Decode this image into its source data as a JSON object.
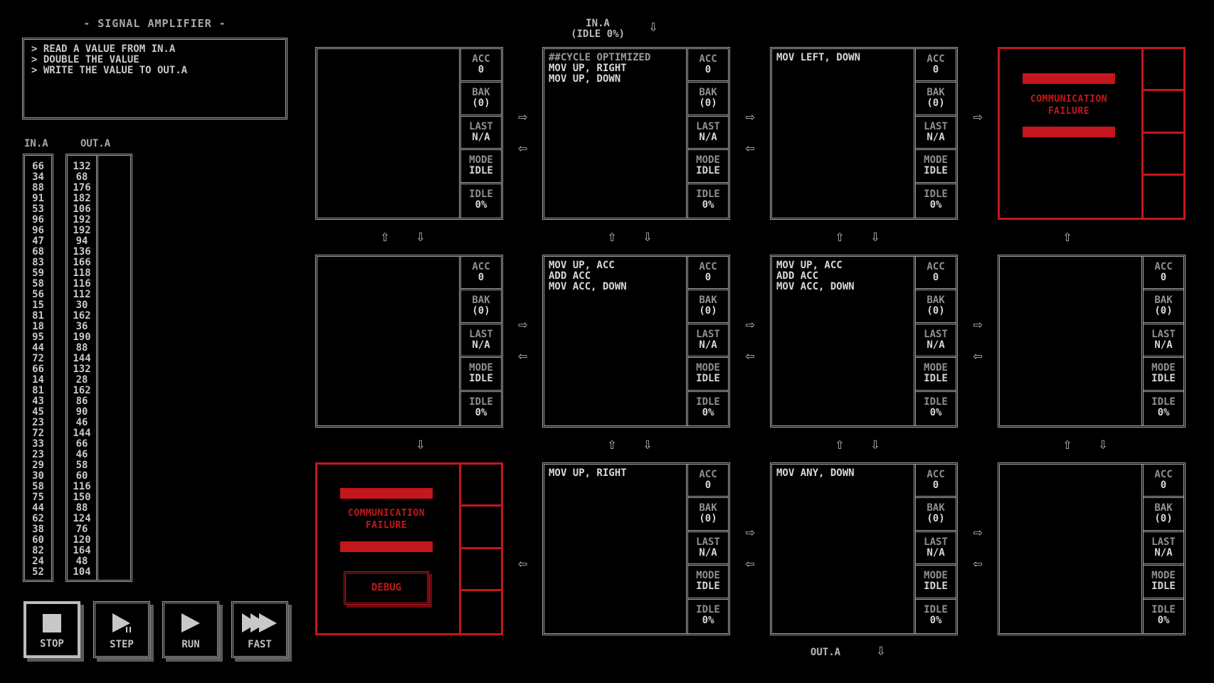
{
  "puzzle": {
    "title": "- SIGNAL AMPLIFIER -",
    "description": [
      "> READ A VALUE FROM IN.A",
      "> DOUBLE THE VALUE",
      "> WRITE THE VALUE TO OUT.A"
    ]
  },
  "streams": {
    "in_label": "IN.A",
    "out_label": "OUT.A",
    "in_values": [
      "66",
      "34",
      "88",
      "91",
      "53",
      "96",
      "96",
      "47",
      "68",
      "83",
      "59",
      "58",
      "56",
      "15",
      "81",
      "18",
      "95",
      "44",
      "72",
      "66",
      "14",
      "81",
      "43",
      "45",
      "23",
      "72",
      "33",
      "23",
      "29",
      "30",
      "58",
      "75",
      "44",
      "62",
      "38",
      "60",
      "82",
      "24",
      "52"
    ],
    "out_expected": [
      "132",
      "68",
      "176",
      "182",
      "106",
      "192",
      "192",
      "94",
      "136",
      "166",
      "118",
      "116",
      "112",
      "30",
      "162",
      "36",
      "190",
      "88",
      "144",
      "132",
      "28",
      "162",
      "86",
      "90",
      "46",
      "144",
      "66",
      "46",
      "58",
      "60",
      "116",
      "150",
      "88",
      "124",
      "76",
      "120",
      "164",
      "48",
      "104"
    ]
  },
  "controls": {
    "stop": "STOP",
    "step": "STEP",
    "run": "RUN",
    "fast": "FAST"
  },
  "io": {
    "input_label": "IN.A",
    "input_status": "(IDLE 0%)",
    "output_label": "OUT.A"
  },
  "register_labels": {
    "acc": "ACC",
    "bak": "BAK",
    "last": "LAST",
    "mode": "MODE",
    "idle": "IDLE"
  },
  "nodes": [
    {
      "code": [],
      "acc": "0",
      "bak": "(0)",
      "last": "N/A",
      "mode": "IDLE",
      "idle": "0%"
    },
    {
      "code": [
        "##CYCLE OPTIMIZED",
        "MOV UP, RIGHT",
        "MOV UP, DOWN"
      ],
      "acc": "0",
      "bak": "(0)",
      "last": "N/A",
      "mode": "IDLE",
      "idle": "0%"
    },
    {
      "code": [
        "MOV LEFT, DOWN"
      ],
      "acc": "0",
      "bak": "(0)",
      "last": "N/A",
      "mode": "IDLE",
      "idle": "0%"
    },
    {
      "failure": true
    },
    {
      "code": [],
      "acc": "0",
      "bak": "(0)",
      "last": "N/A",
      "mode": "IDLE",
      "idle": "0%"
    },
    {
      "code": [
        "MOV UP, ACC",
        "ADD ACC",
        "MOV ACC, DOWN"
      ],
      "acc": "0",
      "bak": "(0)",
      "last": "N/A",
      "mode": "IDLE",
      "idle": "0%"
    },
    {
      "code": [
        "MOV UP, ACC",
        "ADD ACC",
        "MOV ACC, DOWN"
      ],
      "acc": "0",
      "bak": "(0)",
      "last": "N/A",
      "mode": "IDLE",
      "idle": "0%"
    },
    {
      "code": [],
      "acc": "0",
      "bak": "(0)",
      "last": "N/A",
      "mode": "IDLE",
      "idle": "0%"
    },
    {
      "failure": true,
      "debug": true
    },
    {
      "code": [
        "MOV UP, RIGHT"
      ],
      "acc": "0",
      "bak": "(0)",
      "last": "N/A",
      "mode": "IDLE",
      "idle": "0%"
    },
    {
      "code": [
        "MOV ANY, DOWN"
      ],
      "acc": "0",
      "bak": "(0)",
      "last": "N/A",
      "mode": "IDLE",
      "idle": "0%"
    },
    {
      "code": [],
      "acc": "0",
      "bak": "(0)",
      "last": "N/A",
      "mode": "IDLE",
      "idle": "0%"
    }
  ],
  "failure": {
    "message_line1": "COMMUNICATION",
    "message_line2": "FAILURE",
    "debug_label": "DEBUG"
  },
  "colors": {
    "failure_red": "#c4161c",
    "border_gray": "#a8a8a8",
    "background": "#000000"
  }
}
